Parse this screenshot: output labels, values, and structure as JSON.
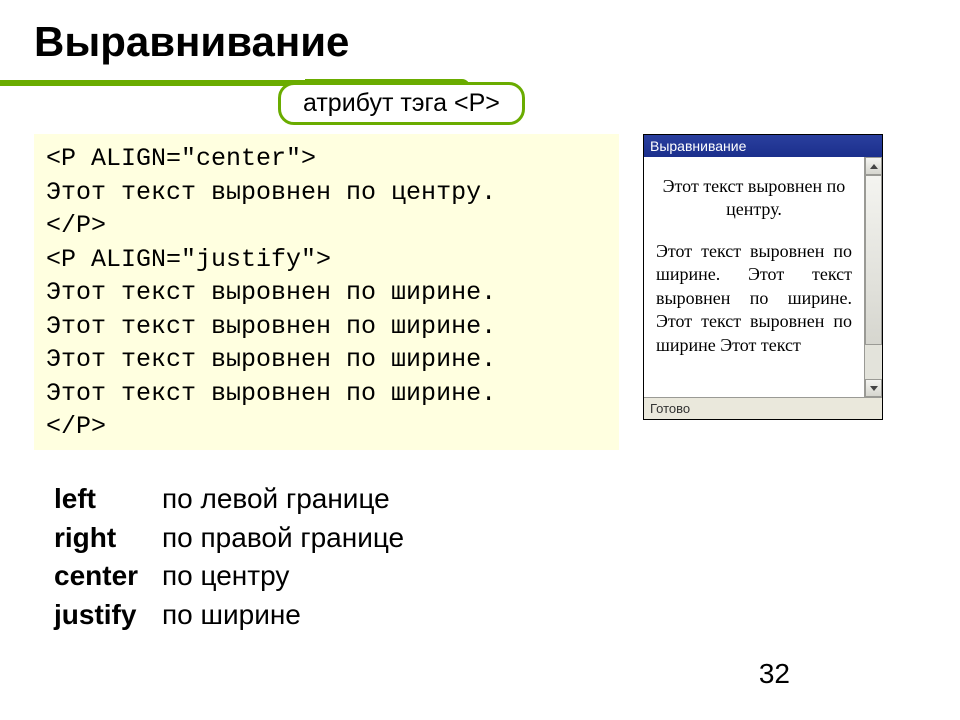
{
  "title": "Выравнивание",
  "attr_label": "атрибут тэга <P>",
  "code": {
    "l1": "<P ALIGN=\"center\">",
    "l2": "Этот текст выровнен по центру.",
    "l3": "</P>",
    "l4": "<P ALIGN=\"justify\">",
    "l5": "Этот текст выровнен по ширине.",
    "l6": "Этот текст выровнен по ширине.",
    "l7": "Этот текст выровнен по ширине.",
    "l8": "Этот текст выровнен по ширине.",
    "l9": "</P>"
  },
  "browser": {
    "title": "Выравнивание",
    "center_text": "Этот текст выровнен по центру.",
    "justify_text": "Этот текст выровнен по ширине. Этот текст выровнен по ширине. Этот текст выровнен по ширине  Этот текст",
    "status": "Готово"
  },
  "align": {
    "r1t": "left",
    "r1d": "по левой границе",
    "r2t": "right",
    "r2d": "по правой границе",
    "r3t": "center",
    "r3d": "по центру",
    "r4t": "justify",
    "r4d": "по ширине"
  },
  "page_number": "32"
}
